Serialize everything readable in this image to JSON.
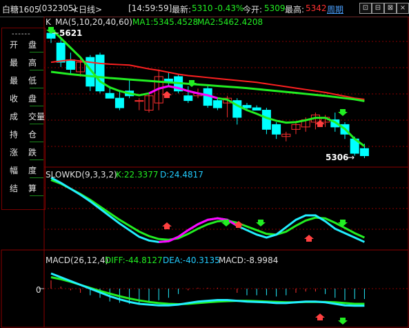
{
  "window": {
    "symbol": "白糖1605",
    "code": "(032305)",
    "period": "<日线>",
    "time": "[14:59:59]",
    "latest_label": "最新:",
    "latest_value": "5310",
    "change_value": "-0.43%",
    "open_label": "今开:",
    "open_value": "5309",
    "high_label": "最高:",
    "high_value": "5342",
    "weekly_label": "周期",
    "buttons": [
      "⊡",
      "⊟",
      "⊠",
      "×"
    ]
  },
  "colors": {
    "background": "#000000",
    "up_candle": "#ff3030",
    "down_candle": "#00ffff",
    "ma_green": "#22ee22",
    "ma_red": "#ff2020",
    "ma_magenta": "#ff00ff",
    "grid_dash": "#8b0000",
    "border": "#8b0000"
  },
  "left_panel": {
    "dashes": "------",
    "rows": [
      {
        "c1": "开",
        "c2": "盘"
      },
      {
        "c1": "最",
        "c2": "高"
      },
      {
        "c1": "最",
        "c2": "低"
      },
      {
        "c1": "收",
        "c2": "盘"
      },
      {
        "c1": "成",
        "c2": "交量"
      },
      {
        "c1": "持",
        "c2": "仓"
      },
      {
        "c1": "涨",
        "c2": "跌"
      },
      {
        "c1": "幅",
        "c2": "度"
      },
      {
        "c1": "结",
        "c2": "算"
      }
    ]
  },
  "main_panel": {
    "k_label": "K",
    "ma_label": "MA(5,10,20,40,60)",
    "ma1_text": "MA1:5345.4528",
    "ma2_text": "MA2:5462.4208",
    "high_marker": "5621",
    "low_marker": "5306"
  },
  "kd_panel": {
    "label": "SLOWKD(9,3,3,2)",
    "k_text": "K:22.3377",
    "d_text": "D:24.4817"
  },
  "macd_panel": {
    "label": "MACD(26,12,4)",
    "diff_text": "DIFF:-44.8127",
    "dea_text": "DEA:-40.3135",
    "macd_text": "MACD:-8.9984",
    "zero_label": "0"
  },
  "chart_data": {
    "type": "candlestick",
    "candles": [
      {
        "o": 5621,
        "h": 5640,
        "l": 5580,
        "c": 5600
      },
      {
        "o": 5580,
        "h": 5600,
        "l": 5480,
        "c": 5500
      },
      {
        "o": 5510,
        "h": 5540,
        "l": 5450,
        "c": 5470
      },
      {
        "o": 5460,
        "h": 5520,
        "l": 5440,
        "c": 5500
      },
      {
        "o": 5520,
        "h": 5530,
        "l": 5380,
        "c": 5400
      },
      {
        "o": 5530,
        "h": 5540,
        "l": 5370,
        "c": 5380
      },
      {
        "o": 5370,
        "h": 5400,
        "l": 5350,
        "c": 5350
      },
      {
        "o": 5350,
        "h": 5380,
        "l": 5300,
        "c": 5310
      },
      {
        "o": 5380,
        "h": 5430,
        "l": 5350,
        "c": 5360
      },
      {
        "o": 5340,
        "h": 5350,
        "l": 5300,
        "c": 5340
      },
      {
        "o": 5300,
        "h": 5370,
        "l": 5290,
        "c": 5360
      },
      {
        "o": 5330,
        "h": 5470,
        "l": 5300,
        "c": 5440
      },
      {
        "o": 5430,
        "h": 5460,
        "l": 5400,
        "c": 5420
      },
      {
        "o": 5440,
        "h": 5450,
        "l": 5370,
        "c": 5380
      },
      {
        "o": 5360,
        "h": 5400,
        "l": 5330,
        "c": 5340
      },
      {
        "o": 5360,
        "h": 5390,
        "l": 5350,
        "c": 5370
      },
      {
        "o": 5390,
        "h": 5400,
        "l": 5310,
        "c": 5320
      },
      {
        "o": 5340,
        "h": 5350,
        "l": 5300,
        "c": 5310
      },
      {
        "o": 5330,
        "h": 5360,
        "l": 5270,
        "c": 5350
      },
      {
        "o": 5340,
        "h": 5350,
        "l": 5240,
        "c": 5270
      },
      {
        "o": 5320,
        "h": 5330,
        "l": 5300,
        "c": 5310
      },
      {
        "o": 5310,
        "h": 5320,
        "l": 5300,
        "c": 5300
      },
      {
        "o": 5300,
        "h": 5310,
        "l": 5200,
        "c": 5220
      },
      {
        "o": 5240,
        "h": 5250,
        "l": 5180,
        "c": 5200
      },
      {
        "o": 5190,
        "h": 5210,
        "l": 5170,
        "c": 5200
      },
      {
        "o": 5220,
        "h": 5250,
        "l": 5200,
        "c": 5240
      },
      {
        "o": 5230,
        "h": 5270,
        "l": 5210,
        "c": 5260
      },
      {
        "o": 5250,
        "h": 5290,
        "l": 5220,
        "c": 5280
      },
      {
        "o": 5250,
        "h": 5280,
        "l": 5230,
        "c": 5270
      },
      {
        "o": 5260,
        "h": 5290,
        "l": 5210,
        "c": 5230
      },
      {
        "o": 5240,
        "h": 5250,
        "l": 5180,
        "c": 5200
      },
      {
        "o": 5180,
        "h": 5190,
        "l": 5110,
        "c": 5120
      },
      {
        "o": 5140,
        "h": 5160,
        "l": 5100,
        "c": 5110
      }
    ],
    "ma_green_long": [
      5460,
      5455,
      5450,
      5446,
      5442,
      5438,
      5434,
      5431,
      5428,
      5425,
      5422,
      5419,
      5416,
      5413,
      5410,
      5407,
      5404,
      5401,
      5398,
      5395,
      5392,
      5388,
      5384,
      5380,
      5376,
      5372,
      5368,
      5364,
      5360,
      5355,
      5350,
      5345,
      5338
    ],
    "ma_red": [
      5500,
      5505,
      5510,
      5505,
      5500,
      5495,
      5492,
      5490,
      5488,
      5480,
      5472,
      5466,
      5458,
      5450,
      5444,
      5440,
      5436,
      5432,
      5428,
      5424,
      5420,
      5416,
      5410,
      5404,
      5398,
      5392,
      5386,
      5380,
      5374,
      5366,
      5358,
      5350,
      5345
    ],
    "ma_fast": [
      5640,
      5600,
      5560,
      5520,
      5470,
      5420,
      5395,
      5380,
      5370,
      5362,
      5370,
      5390,
      5400,
      5392,
      5380,
      5370,
      5362,
      5350,
      5344,
      5320,
      5300,
      5285,
      5268,
      5256,
      5248,
      5250,
      5258,
      5268,
      5268,
      5250,
      5222,
      5180,
      5150
    ],
    "kd_k": [
      95,
      88,
      80,
      72,
      63,
      53,
      43,
      33,
      24,
      15,
      10,
      8,
      9,
      15,
      24,
      32,
      38,
      40,
      38,
      30,
      24,
      18,
      14,
      18,
      28,
      38,
      44,
      44,
      36,
      26,
      20,
      14,
      8
    ],
    "kd_d": [
      92,
      87,
      80,
      73,
      65,
      56,
      47,
      38,
      30,
      22,
      16,
      12,
      11,
      13,
      19,
      26,
      32,
      36,
      37,
      34,
      29,
      24,
      19,
      18,
      22,
      30,
      37,
      41,
      40,
      34,
      27,
      20,
      14
    ],
    "macd_diff": [
      40,
      30,
      20,
      10,
      0,
      -10,
      -20,
      -28,
      -35,
      -40,
      -42,
      -44,
      -44,
      -42,
      -38,
      -34,
      -32,
      -30,
      -30,
      -32,
      -34,
      -35,
      -36,
      -38,
      -38,
      -36,
      -34,
      -34,
      -36,
      -40,
      -44,
      -45,
      -45
    ],
    "macd_dea": [
      30,
      25,
      18,
      10,
      2,
      -6,
      -13,
      -20,
      -26,
      -31,
      -35,
      -38,
      -40,
      -41,
      -40,
      -38,
      -36,
      -34,
      -33,
      -32,
      -32,
      -33,
      -34,
      -35,
      -36,
      -36,
      -35,
      -35,
      -35,
      -36,
      -38,
      -40,
      -40
    ],
    "y_range": [
      5100,
      5650
    ]
  }
}
